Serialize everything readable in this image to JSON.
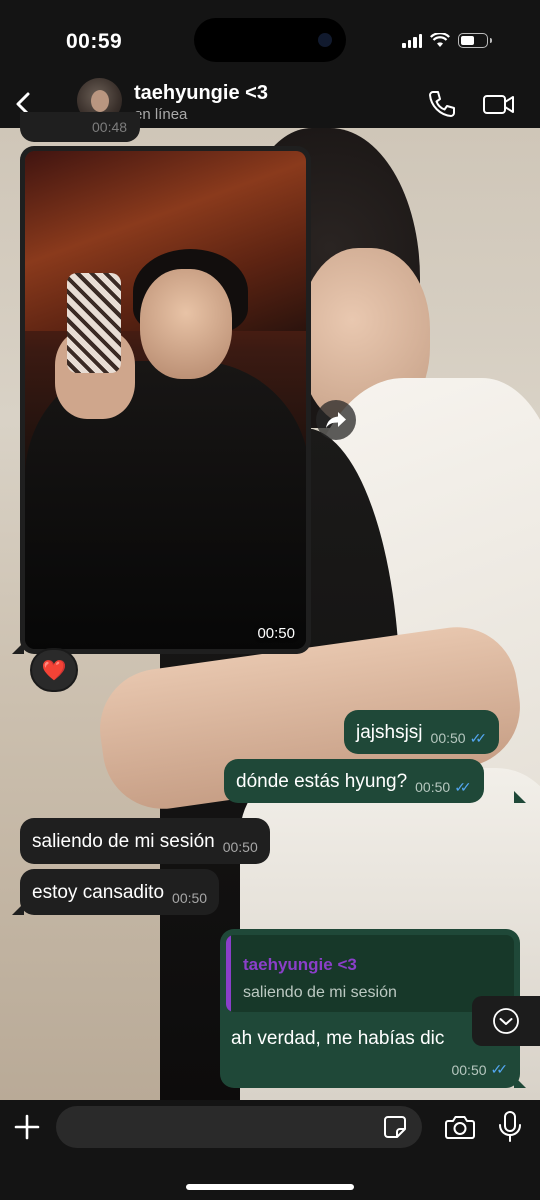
{
  "status_bar": {
    "time": "00:59"
  },
  "header": {
    "contact_name": "taehyungie <3",
    "contact_status": "en línea"
  },
  "messages": {
    "top_partial_time": "00:48",
    "image_time": "00:50",
    "reaction": "❤️",
    "m1": {
      "text": "jajshsjsj",
      "time": "00:50"
    },
    "m2": {
      "text": "dónde estás hyung?",
      "time": "00:50"
    },
    "m3": {
      "text": "saliendo de mi sesión",
      "time": "00:50"
    },
    "m4": {
      "text": "estoy cansadito",
      "time": "00:50"
    },
    "reply": {
      "quoted_name": "taehyungie <3",
      "quoted_text": "saliendo de mi sesión",
      "text": "ah verdad, me habías dic",
      "time": "00:50"
    }
  },
  "colors": {
    "outgoing_bubble": "#1f4838",
    "incoming_bubble": "#1f1f1f",
    "read_ticks": "#53a6f0",
    "quote_accent": "#8a3fc9"
  },
  "icons": [
    "back-chevron-icon",
    "phone-icon",
    "video-camera-icon",
    "forward-icon",
    "chevron-down-icon",
    "plus-icon",
    "sticker-icon",
    "camera-icon",
    "microphone-icon"
  ]
}
